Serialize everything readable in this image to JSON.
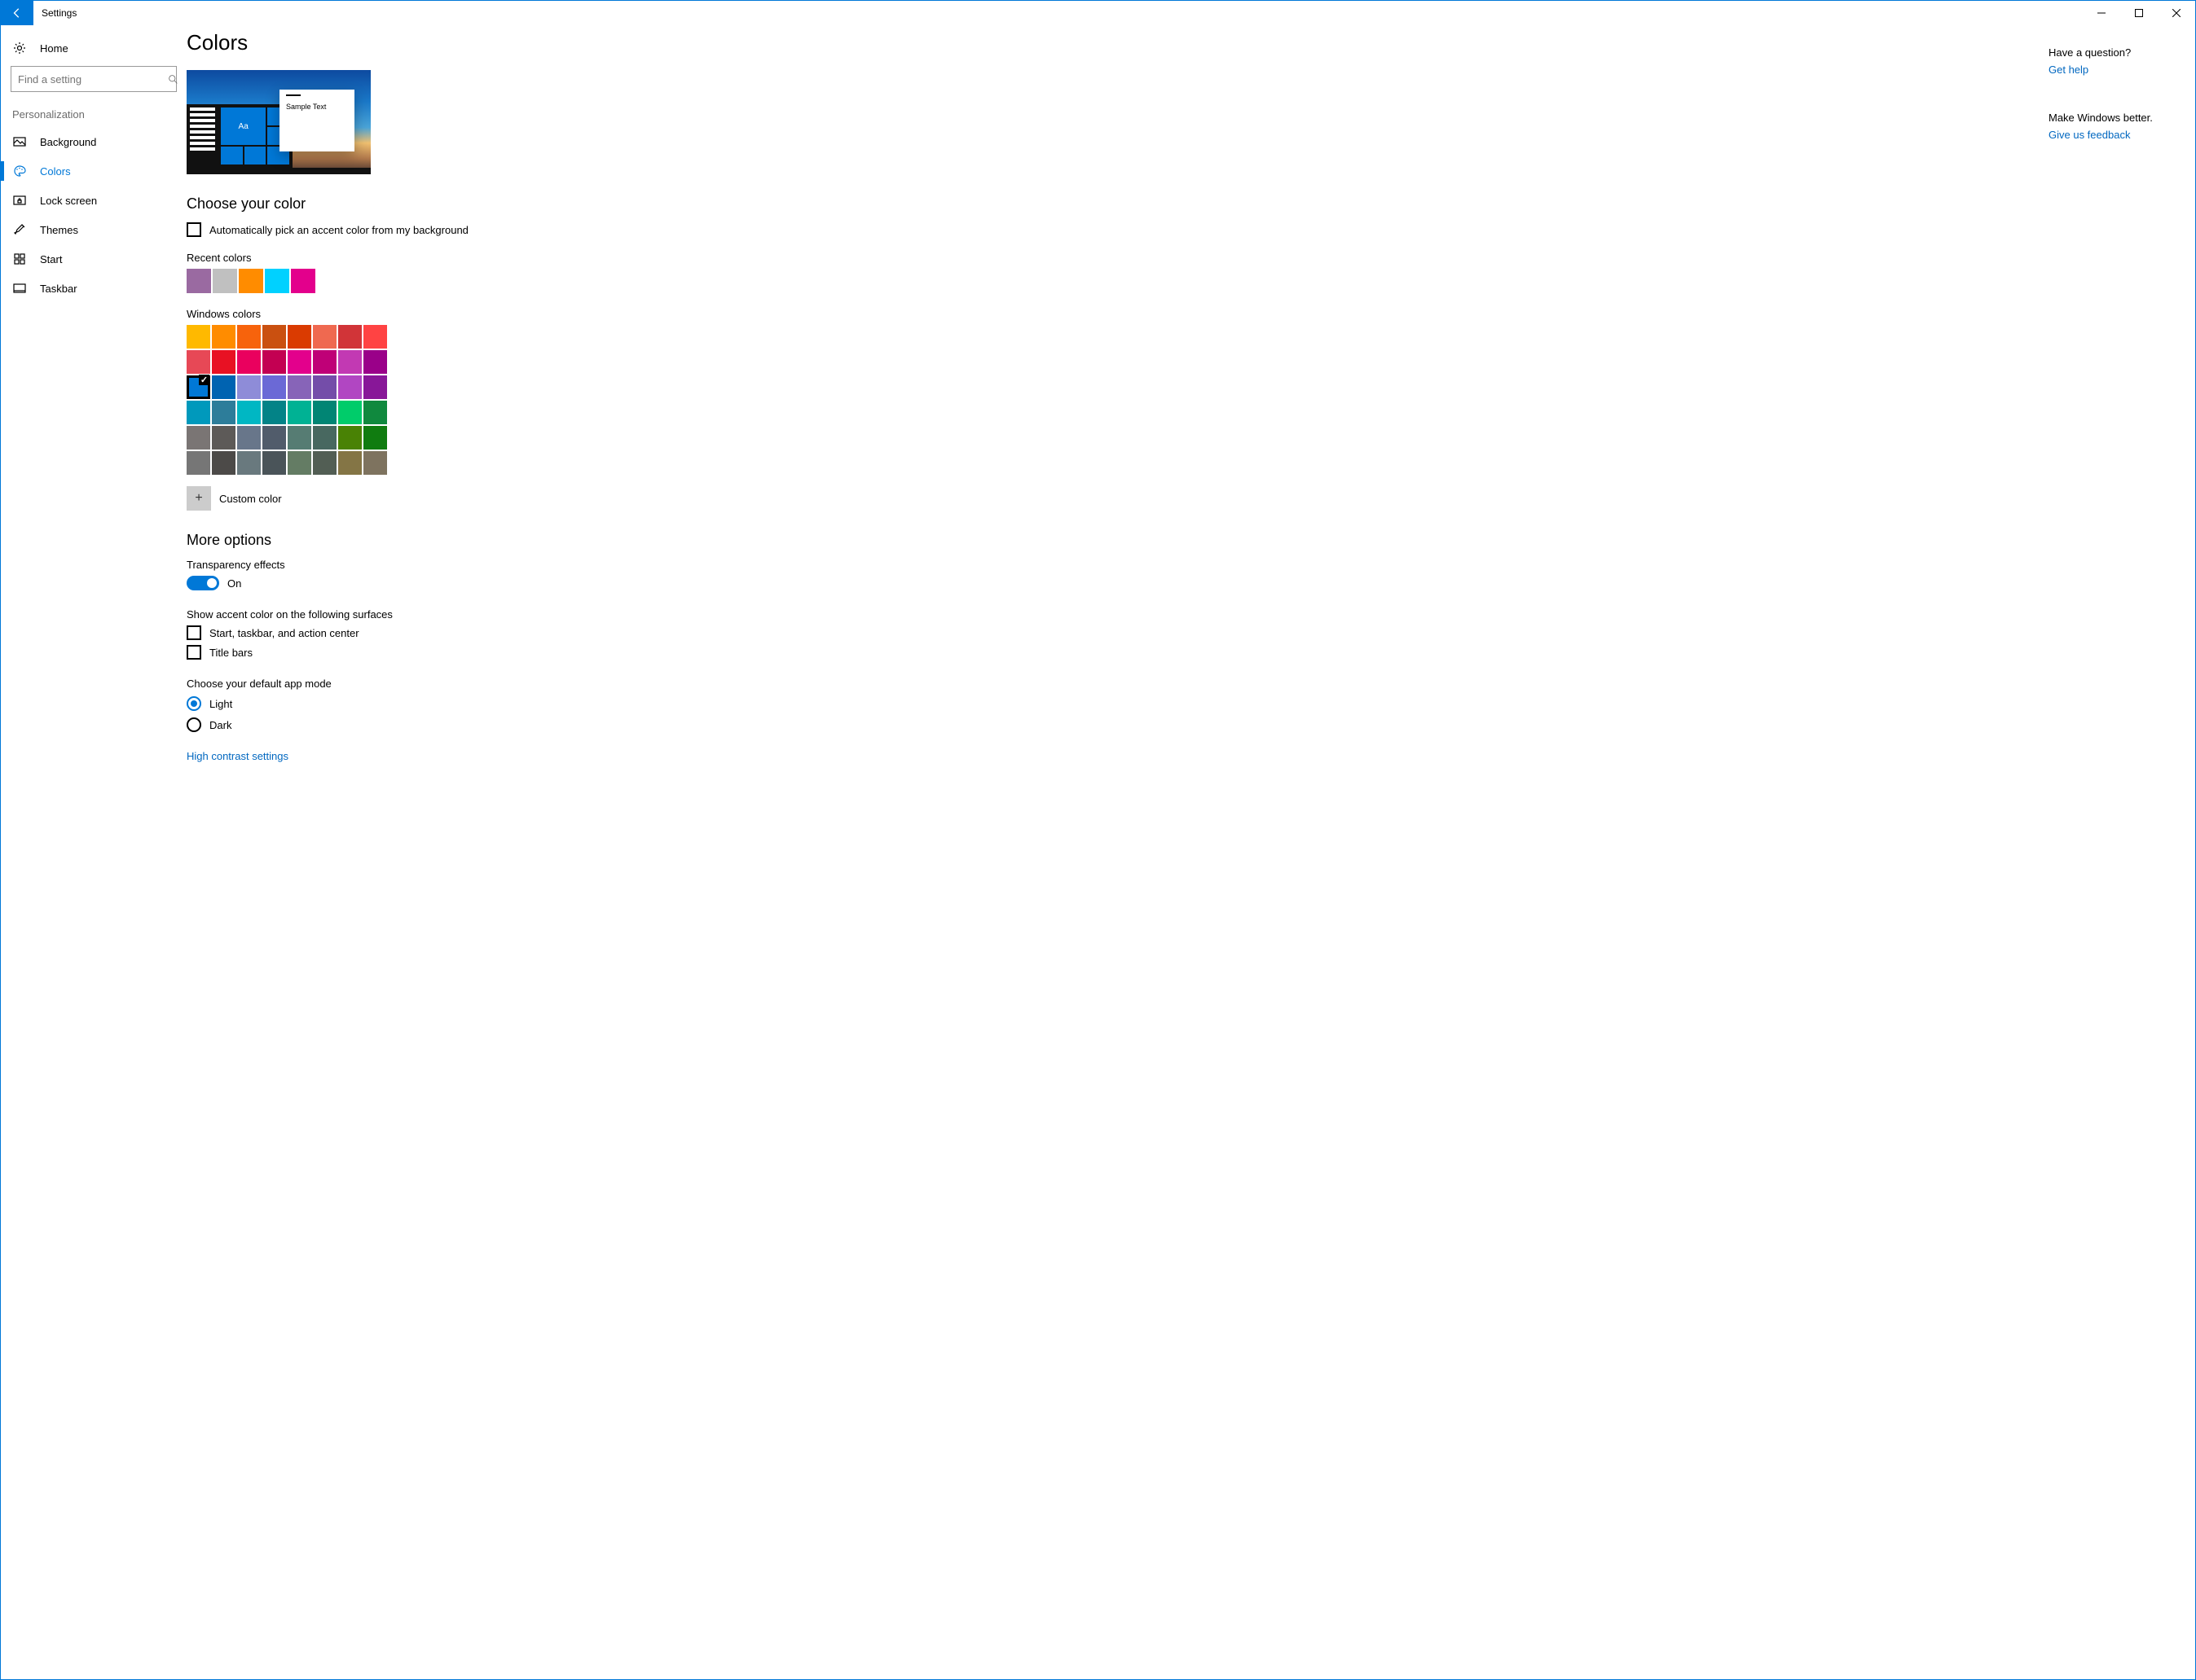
{
  "window": {
    "title": "Settings"
  },
  "sidebar": {
    "home": "Home",
    "search_placeholder": "Find a setting",
    "category": "Personalization",
    "items": [
      {
        "label": "Background"
      },
      {
        "label": "Colors"
      },
      {
        "label": "Lock screen"
      },
      {
        "label": "Themes"
      },
      {
        "label": "Start"
      },
      {
        "label": "Taskbar"
      }
    ]
  },
  "page": {
    "title": "Colors",
    "preview_sample": "Sample Text",
    "preview_aa": "Aa",
    "choose_color": "Choose your color",
    "auto_pick": "Automatically pick an accent color from my background",
    "recent_label": "Recent colors",
    "recent_colors": [
      "#9a6aa1",
      "#c0c0c0",
      "#ff8c00",
      "#00d1ff",
      "#e3008c"
    ],
    "windows_colors_label": "Windows colors",
    "windows_colors": [
      "#ffb900",
      "#ff8c00",
      "#f7630c",
      "#ca5010",
      "#da3b01",
      "#ef6950",
      "#d13438",
      "#ff4343",
      "#e74856",
      "#e81123",
      "#ea005e",
      "#c30052",
      "#e3008c",
      "#bf0077",
      "#c239b3",
      "#9a0089",
      "#0078d7",
      "#0063b1",
      "#8e8cd8",
      "#6b69d6",
      "#8764b8",
      "#744da9",
      "#b146c2",
      "#881798",
      "#0099bc",
      "#2d7d9a",
      "#00b7c3",
      "#038387",
      "#00b294",
      "#018574",
      "#00cc6a",
      "#10893e",
      "#7a7574",
      "#5d5a58",
      "#68768a",
      "#515c6b",
      "#567c73",
      "#486860",
      "#498205",
      "#107c10",
      "#767676",
      "#4c4a48",
      "#69797e",
      "#4a5459",
      "#647c64",
      "#525e54",
      "#847545",
      "#7e735f"
    ],
    "selected_color_index": 16,
    "custom_color": "Custom color",
    "more_options": "More options",
    "transparency_label": "Transparency effects",
    "transparency_value": "On",
    "surfaces_label": "Show accent color on the following surfaces",
    "surface_start": "Start, taskbar, and action center",
    "surface_title": "Title bars",
    "app_mode_label": "Choose your default app mode",
    "mode_light": "Light",
    "mode_dark": "Dark",
    "high_contrast": "High contrast settings"
  },
  "right": {
    "q": "Have a question?",
    "help": "Get help",
    "better": "Make Windows better.",
    "feedback": "Give us feedback"
  }
}
